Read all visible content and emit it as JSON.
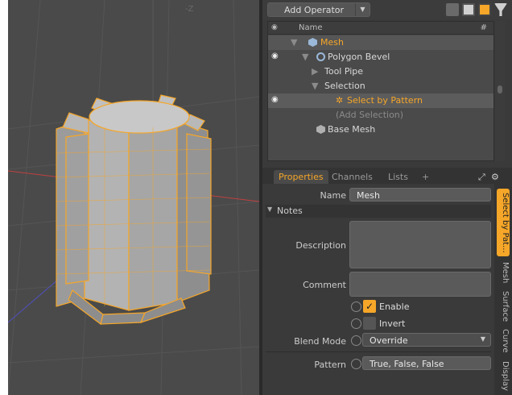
{
  "viewport": {
    "axis_label": "-Z"
  },
  "toolbar": {
    "add_operator_label": "Add Operator",
    "icons": [
      "stack-icon",
      "list-icon",
      "pipe-icon",
      "filter-icon"
    ]
  },
  "tree": {
    "columns": {
      "name": "Name",
      "hash": "#"
    },
    "rows": [
      {
        "label": "Mesh",
        "icon": "mesh-cube-icon"
      },
      {
        "label": "Polygon Bevel",
        "icon": "bevel-icon"
      },
      {
        "label": "Tool Pipe"
      },
      {
        "label": "Selection"
      },
      {
        "label": "Select by Pattern",
        "icon": "gear-icon"
      },
      {
        "label": "(Add Selection)"
      },
      {
        "label": "Base Mesh",
        "icon": "mesh-cube-icon"
      }
    ]
  },
  "tabs": {
    "properties": "Properties",
    "channels": "Channels",
    "lists": "Lists",
    "add": "+"
  },
  "properties": {
    "name_label": "Name",
    "name_value": "Mesh",
    "notes_section": "Notes",
    "description_label": "Description",
    "comment_label": "Comment",
    "enable_label": "Enable",
    "invert_label": "Invert",
    "blend_mode_label": "Blend Mode",
    "blend_mode_value": "Override",
    "pattern_label": "Pattern",
    "pattern_value": "True, False, False"
  },
  "vtabs": {
    "select_by_pattern": "Select by Pat...",
    "mesh": "Mesh",
    "surface": "Surface",
    "curve": "Curve",
    "display": "Display"
  },
  "colors": {
    "accent": "#f6a628",
    "panel": "#3a3a3a",
    "viewport": "#4a4a4a"
  }
}
